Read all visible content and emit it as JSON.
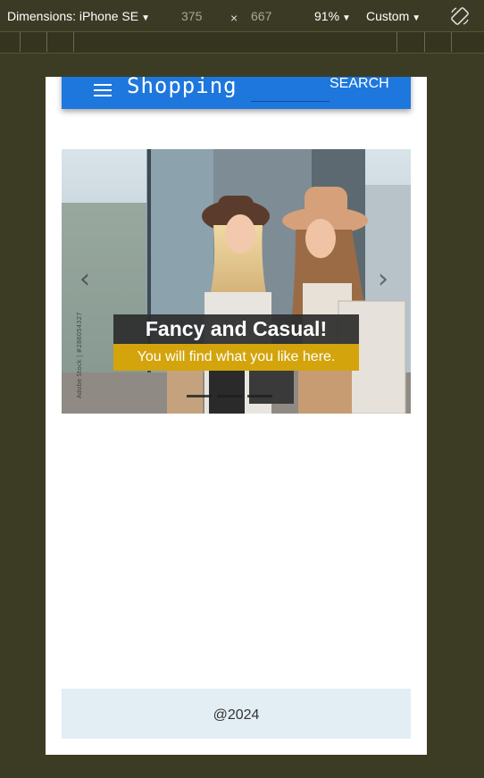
{
  "devtools": {
    "device_label": "Dimensions: iPhone SE",
    "width": "375",
    "times": "×",
    "height": "667",
    "zoom": "91%",
    "throttle": "Custom"
  },
  "navbar": {
    "brand": "Shopping",
    "search_placeholder": "",
    "search_label": "SEARCH",
    "color": "#1e77dd"
  },
  "carousel": {
    "title": "Fancy and Casual!",
    "subtitle": "You will find what you like here.",
    "watermark": "Adobe Stock | #286054327",
    "prev_icon": "chevron-left-icon",
    "next_icon": "chevron-right-icon",
    "slide_count": 3
  },
  "footer": {
    "text": "@2024",
    "background": "#e3eef4"
  }
}
